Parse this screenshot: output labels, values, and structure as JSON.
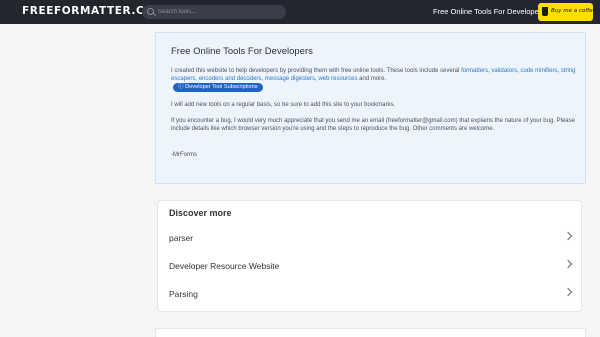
{
  "header": {
    "logo": "FREEFORMATTER.COM",
    "search_placeholder": "Search tools...",
    "link": "Free Online Tools For Developers",
    "coffee_label": "Buy me a coffee"
  },
  "about": {
    "title": "Free Online Tools For Developers",
    "p1_intro": "I created this website to help developers by providing them with free online tools. These tools include several ",
    "p1_links": [
      "formatters",
      "validators",
      "code minifiers",
      "string escapers",
      "encoders and decoders",
      "message digesters",
      "web resources"
    ],
    "p1_sep": ", ",
    "p1_and": " and more.",
    "badge": "Developer Tool Subscriptions",
    "p2": "I will add new tools on a regular basis, so be sure to add this site to your bookmarks.",
    "p3": "If you encounter a bug, I would very much appreciate that you send me an email (freeformatter@gmail.com) that explains the nature of your bug. Please include details like which browser version you're using and the steps to reproduce the bug. Other comments are welcome.",
    "p4": "-MrForms"
  },
  "discover": {
    "title": "Discover more",
    "items": [
      "parser",
      "Developer Resource Website",
      "Parsing"
    ]
  },
  "colors": {
    "topbar": "#23262f",
    "coffee": "#ffdd00",
    "link": "#2a78c8",
    "badge": "#1f63c6"
  },
  "icons": [
    "search-icon",
    "coffee-cup-icon",
    "chevron-right-icon",
    "info-icon"
  ]
}
